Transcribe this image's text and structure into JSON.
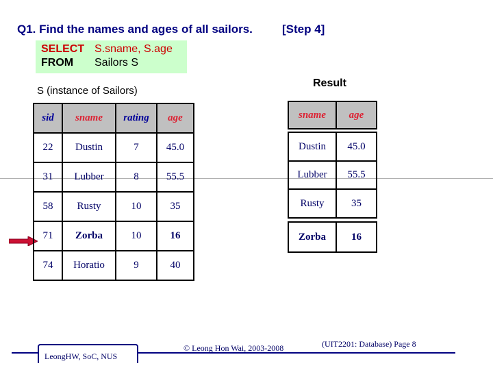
{
  "slide": {
    "title": "Q1. Find the names and ages of all sailors.",
    "step": "[Step 4]"
  },
  "sql": {
    "select_kw": "SELECT",
    "select_expr": "S.sname, S.age",
    "from_kw": "FROM",
    "from_expr": "Sailors S"
  },
  "instance_table": {
    "label": "S (instance of Sailors)",
    "headers": [
      "sid",
      "sname",
      "rating",
      "age"
    ],
    "rows": [
      [
        "22",
        "Dustin",
        "7",
        "45.0"
      ],
      [
        "31",
        "Lubber",
        "8",
        "55.5"
      ],
      [
        "58",
        "Rusty",
        "10",
        "35"
      ],
      [
        "71",
        "Zorba",
        "10",
        "16"
      ],
      [
        "74",
        "Horatio",
        "9",
        "40"
      ]
    ],
    "highlighted_row_index": 3
  },
  "result_table": {
    "label": "Result",
    "headers": [
      "sname",
      "age"
    ],
    "rows": [
      [
        "Dustin",
        "45.0"
      ],
      [
        "Lubber",
        "55.5"
      ],
      [
        "Rusty",
        "35"
      ],
      [
        "Zorba",
        "16"
      ]
    ]
  },
  "colors": {
    "title": "#000080",
    "sql_bg": "#ccffcc",
    "keyword_red": "#cc0000",
    "header_blue": "#000099",
    "header_red": "#dd2233",
    "header_bg": "#c0c0c0",
    "arrow": "#cc1133"
  },
  "footer": {
    "left_box": "LeongHW, SoC, NUS",
    "copyright": "© Leong Hon Wai, 2003-2008",
    "page": "(UIT2201: Database) Page 8"
  }
}
